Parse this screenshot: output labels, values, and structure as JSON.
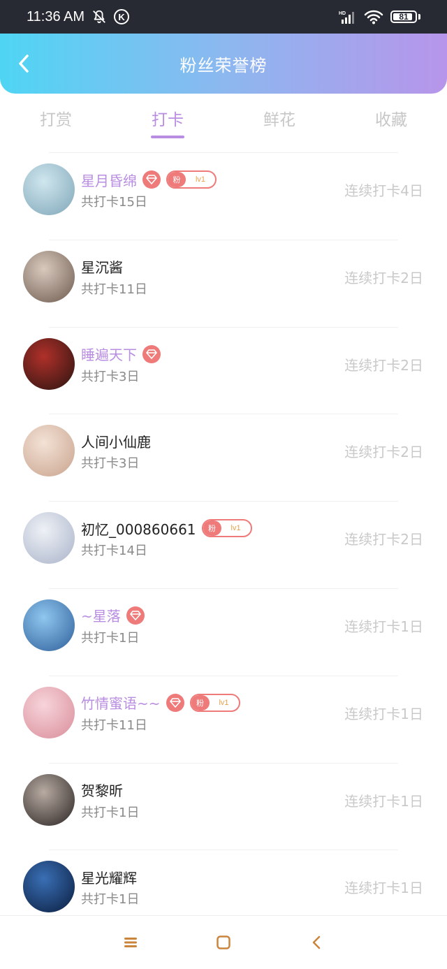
{
  "status_bar": {
    "time": "11:36 AM",
    "icons": [
      "bell-off-icon",
      "k-icon",
      "signal-icon",
      "wifi-icon",
      "battery-icon"
    ],
    "k_label": "K",
    "network_label": "HD",
    "battery_level": "81"
  },
  "header": {
    "title": "粉丝荣誉榜",
    "back_icon": "chevron-left-icon",
    "gradient": [
      "#4fd5f4",
      "#b795ea"
    ]
  },
  "tabs": [
    {
      "label": "打赏",
      "active": false
    },
    {
      "label": "打卡",
      "active": true
    },
    {
      "label": "鲜花",
      "active": false
    },
    {
      "label": "收藏",
      "active": false
    }
  ],
  "colors": {
    "accent": "#b98ee2",
    "badge": "#ee7a7a",
    "muted": "#c9c9c9"
  },
  "fans": [
    {
      "name": "星月昏绵",
      "vip": true,
      "diamond": true,
      "fan_badge": {
        "label": "粉",
        "level": "lv1"
      },
      "total": "共打卡15日",
      "streak": "连续打卡4日",
      "avatar_colors": [
        "#cfe6ee",
        "#7fa6b8"
      ]
    },
    {
      "name": "星沉酱",
      "vip": false,
      "diamond": false,
      "fan_badge": null,
      "total": "共打卡11日",
      "streak": "连续打卡2日",
      "avatar_colors": [
        "#d9c9bd",
        "#6d5a4f"
      ]
    },
    {
      "name": "睡遍天下",
      "vip": true,
      "diamond": true,
      "fan_badge": null,
      "total": "共打卡3日",
      "streak": "连续打卡2日",
      "avatar_colors": [
        "#b0302a",
        "#2a1410"
      ]
    },
    {
      "name": "人间小仙鹿",
      "vip": false,
      "diamond": false,
      "fan_badge": null,
      "total": "共打卡3日",
      "streak": "连续打卡2日",
      "avatar_colors": [
        "#f3e2d6",
        "#c9a38d"
      ]
    },
    {
      "name": "初忆_000860661",
      "vip": false,
      "diamond": false,
      "fan_badge": {
        "label": "粉",
        "level": "lv1"
      },
      "total": "共打卡14日",
      "streak": "连续打卡2日",
      "avatar_colors": [
        "#eef1f6",
        "#a9b3c9"
      ]
    },
    {
      "name": "~星落",
      "vip": true,
      "diamond": true,
      "fan_badge": null,
      "total": "共打卡1日",
      "streak": "连续打卡1日",
      "avatar_colors": [
        "#8fc7ef",
        "#2f5f9a"
      ]
    },
    {
      "name": "竹情蜜语~~",
      "vip": true,
      "diamond": true,
      "fan_badge": {
        "label": "粉",
        "level": "lv1"
      },
      "total": "共打卡11日",
      "streak": "连续打卡1日",
      "avatar_colors": [
        "#f7d4da",
        "#d98d9a"
      ]
    },
    {
      "name": "贺黎昕",
      "vip": false,
      "diamond": false,
      "fan_badge": null,
      "total": "共打卡1日",
      "streak": "连续打卡1日",
      "avatar_colors": [
        "#b7aba2",
        "#2a2322"
      ]
    },
    {
      "name": "星光耀辉",
      "vip": false,
      "diamond": false,
      "fan_badge": null,
      "total": "共打卡1日",
      "streak": "连续打卡1日",
      "avatar_colors": [
        "#3a6fb5",
        "#0a1d3e"
      ]
    }
  ],
  "bottom_nav": {
    "items": [
      "menu-icon",
      "home-square-icon",
      "back-chevron-icon"
    ]
  }
}
